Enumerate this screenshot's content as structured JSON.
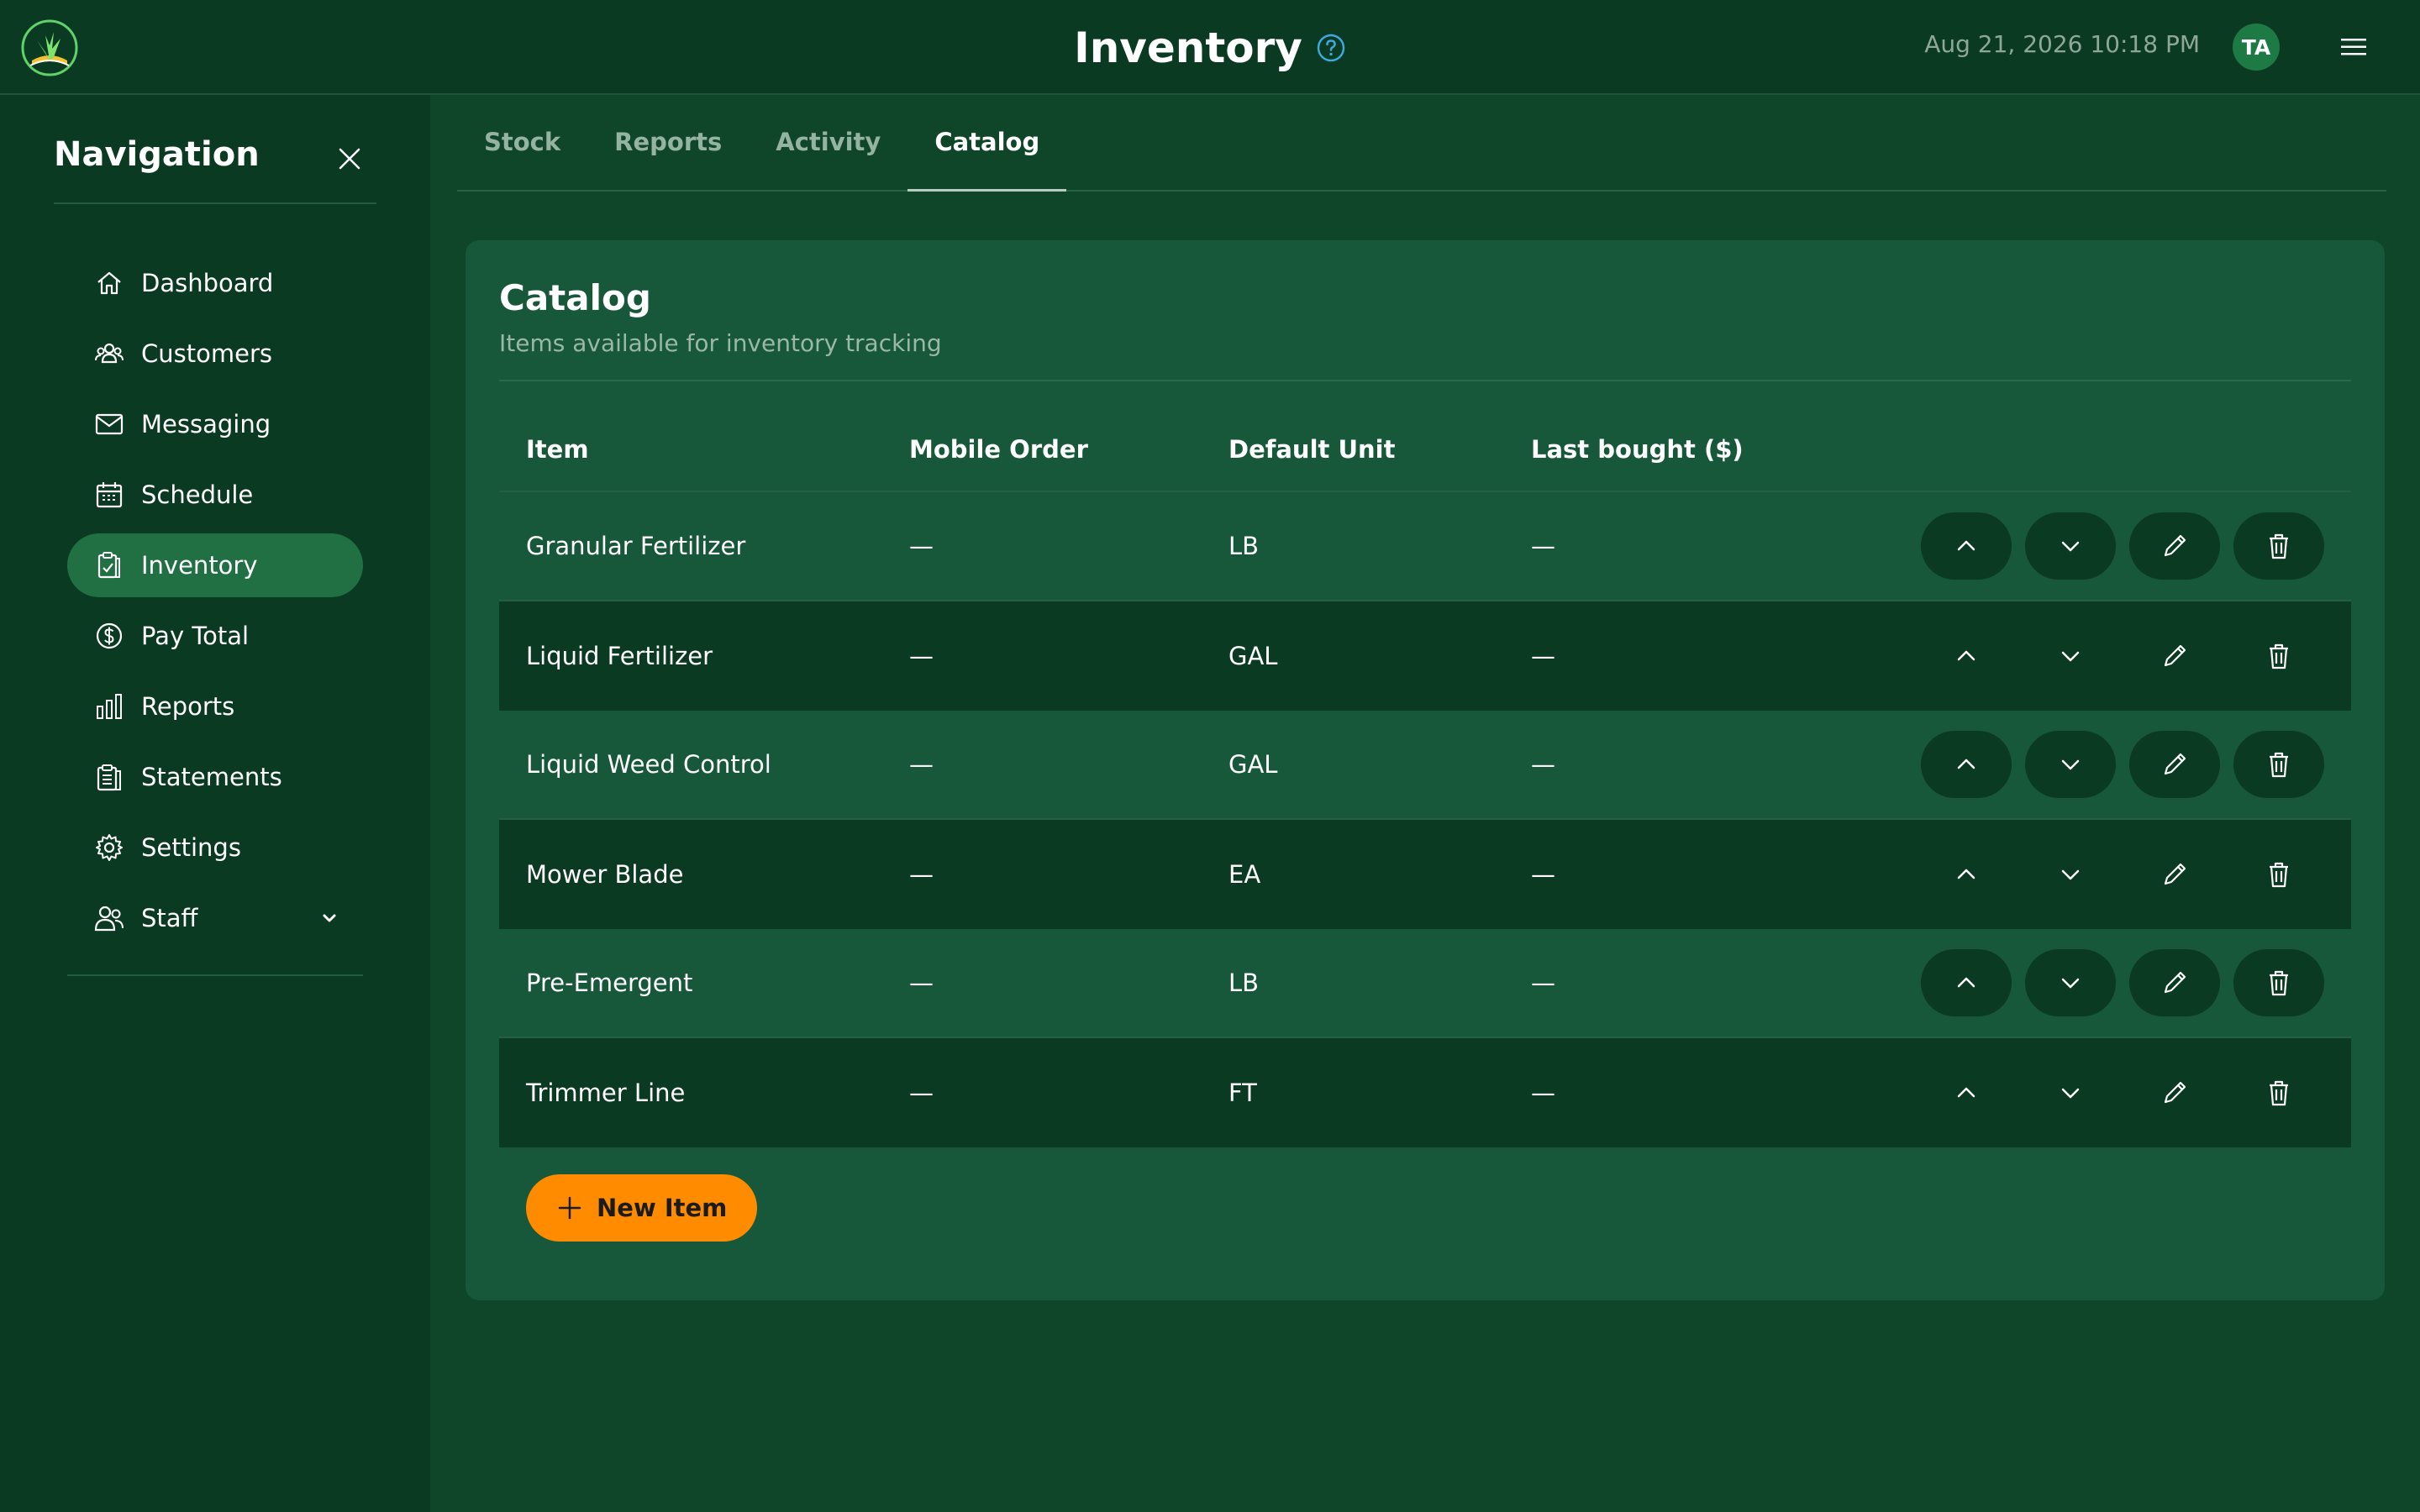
{
  "header": {
    "title": "Inventory",
    "datetime": "Aug 21, 2026 10:18 PM",
    "avatar_initials": "TA"
  },
  "sidebar": {
    "title": "Navigation",
    "items": [
      {
        "label": "Dashboard",
        "icon": "home-icon"
      },
      {
        "label": "Customers",
        "icon": "users-icon"
      },
      {
        "label": "Messaging",
        "icon": "mail-icon"
      },
      {
        "label": "Schedule",
        "icon": "calendar-icon"
      },
      {
        "label": "Inventory",
        "icon": "clipboard-icon",
        "active": true
      },
      {
        "label": "Pay Total",
        "icon": "dollar-icon"
      },
      {
        "label": "Reports",
        "icon": "bar-chart-icon"
      },
      {
        "label": "Statements",
        "icon": "document-icon"
      },
      {
        "label": "Settings",
        "icon": "gear-icon"
      },
      {
        "label": "Staff",
        "icon": "staff-icon",
        "has_dropdown": true
      }
    ]
  },
  "tabs": [
    {
      "label": "Stock"
    },
    {
      "label": "Reports"
    },
    {
      "label": "Activity"
    },
    {
      "label": "Catalog",
      "active": true
    }
  ],
  "catalog": {
    "title": "Catalog",
    "subtitle": "Items available for inventory tracking",
    "columns": [
      "Item",
      "Mobile Order",
      "Default Unit",
      "Last bought ($)"
    ],
    "rows": [
      {
        "item": "Granular Fertilizer",
        "mobile_order": "—",
        "unit": "LB",
        "last_bought": "—"
      },
      {
        "item": "Liquid Fertilizer",
        "mobile_order": "—",
        "unit": "GAL",
        "last_bought": "—"
      },
      {
        "item": "Liquid Weed Control",
        "mobile_order": "—",
        "unit": "GAL",
        "last_bought": "—"
      },
      {
        "item": "Mower Blade",
        "mobile_order": "—",
        "unit": "EA",
        "last_bought": "—"
      },
      {
        "item": "Pre-Emergent",
        "mobile_order": "—",
        "unit": "LB",
        "last_bought": "—"
      },
      {
        "item": "Trimmer Line",
        "mobile_order": "—",
        "unit": "FT",
        "last_bought": "—"
      }
    ],
    "new_item_label": "New Item"
  },
  "colors": {
    "accent": "#ff8c00",
    "background": "#0f4528",
    "sidebar": "#0b3a22",
    "card": "#17573a",
    "active_nav": "#217044",
    "help": "#3da8e0"
  }
}
